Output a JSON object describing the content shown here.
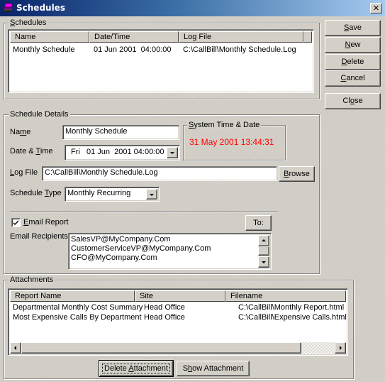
{
  "window": {
    "title": "Schedules",
    "icon": "app-books-icon",
    "close_icon": "close-icon"
  },
  "schedules_group": {
    "label": "Schedules",
    "columns": [
      "Name",
      "Date/Time",
      "Log File"
    ],
    "rows": [
      {
        "name": "Monthly Schedule",
        "datetime": "01 Jun 2001  04:00:00",
        "logfile": "C:\\CallBill\\Monthly Schedule.Log"
      }
    ]
  },
  "side_buttons": {
    "save": "Save",
    "new": "New",
    "delete": "Delete",
    "cancel": "Cancel",
    "close": "Close"
  },
  "details": {
    "label": "Schedule Details",
    "name_label": "Name",
    "name_value": "Monthly Schedule",
    "datetime_label": "Date & Time",
    "datetime_value": "Fri   01 Jun  2001 04:00:00",
    "system_time_label": "System Time & Date",
    "system_time_value": "31 May 2001 13:44:31",
    "system_time_color": "#ff0000",
    "logfile_label": "Log File",
    "logfile_value": "C:\\CallBill\\Monthly Schedule.Log",
    "browse_label": "Browse",
    "schedule_type_label": "Schedule Type",
    "schedule_type_value": "Monthly Recurring",
    "email_report_label": "Email Report",
    "email_report_checked": true,
    "to_label": "To:",
    "recipients_label": "Email Recipients",
    "recipients": [
      "SalesVP@MyCompany.Com",
      "CustomerServiceVP@MyCompany.Com",
      "CFO@MyCompany.Com"
    ]
  },
  "attachments": {
    "label": "Attachments",
    "columns": [
      "Report Name",
      "Site",
      "Filename"
    ],
    "rows": [
      {
        "report": "Departmental Monthly Cost Summary",
        "site": "Head Office",
        "filename": "C:\\CallBill\\Monthly Report.html"
      },
      {
        "report": "Most Expensive Calls By Department",
        "site": "Head Office",
        "filename": "C:\\CallBill\\Expensive Calls.html"
      }
    ],
    "delete_label": "Delete Attachment",
    "show_label": "Show Attachment"
  }
}
